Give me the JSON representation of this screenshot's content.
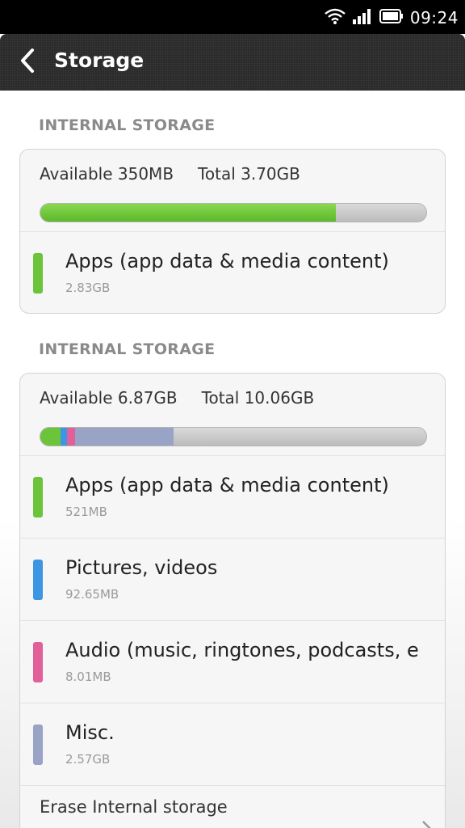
{
  "status_bar": {
    "time": "09:24",
    "icons": [
      "wifi-icon",
      "signal-icon",
      "battery-icon"
    ]
  },
  "header": {
    "title": "Storage",
    "back_icon": "chevron-left-icon"
  },
  "sections": [
    {
      "header": "INTERNAL STORAGE",
      "available": "Available 350MB",
      "total": "Total 3.70GB",
      "used_fraction": 0.76,
      "items": [
        {
          "label": "Apps (app data & media content)",
          "size": "2.83GB",
          "color": "#6cc43a"
        }
      ]
    },
    {
      "header": "INTERNAL STORAGE",
      "available": "Available 6.87GB",
      "total": "Total 10.06GB",
      "used_fraction": 0.32,
      "items": [
        {
          "label": "Apps (app data & media content)",
          "size": "521MB",
          "color": "#6cc43a"
        },
        {
          "label": "Pictures, videos",
          "size": "92.65MB",
          "color": "#3d96e3"
        },
        {
          "label": "Audio (music, ringtones, podcasts, e",
          "size": "8.01MB",
          "color": "#e2609a"
        },
        {
          "label": "Misc.",
          "size": "2.57GB",
          "color": "#98a3c6"
        }
      ],
      "erase": {
        "label": "Erase Internal storage"
      }
    }
  ]
}
